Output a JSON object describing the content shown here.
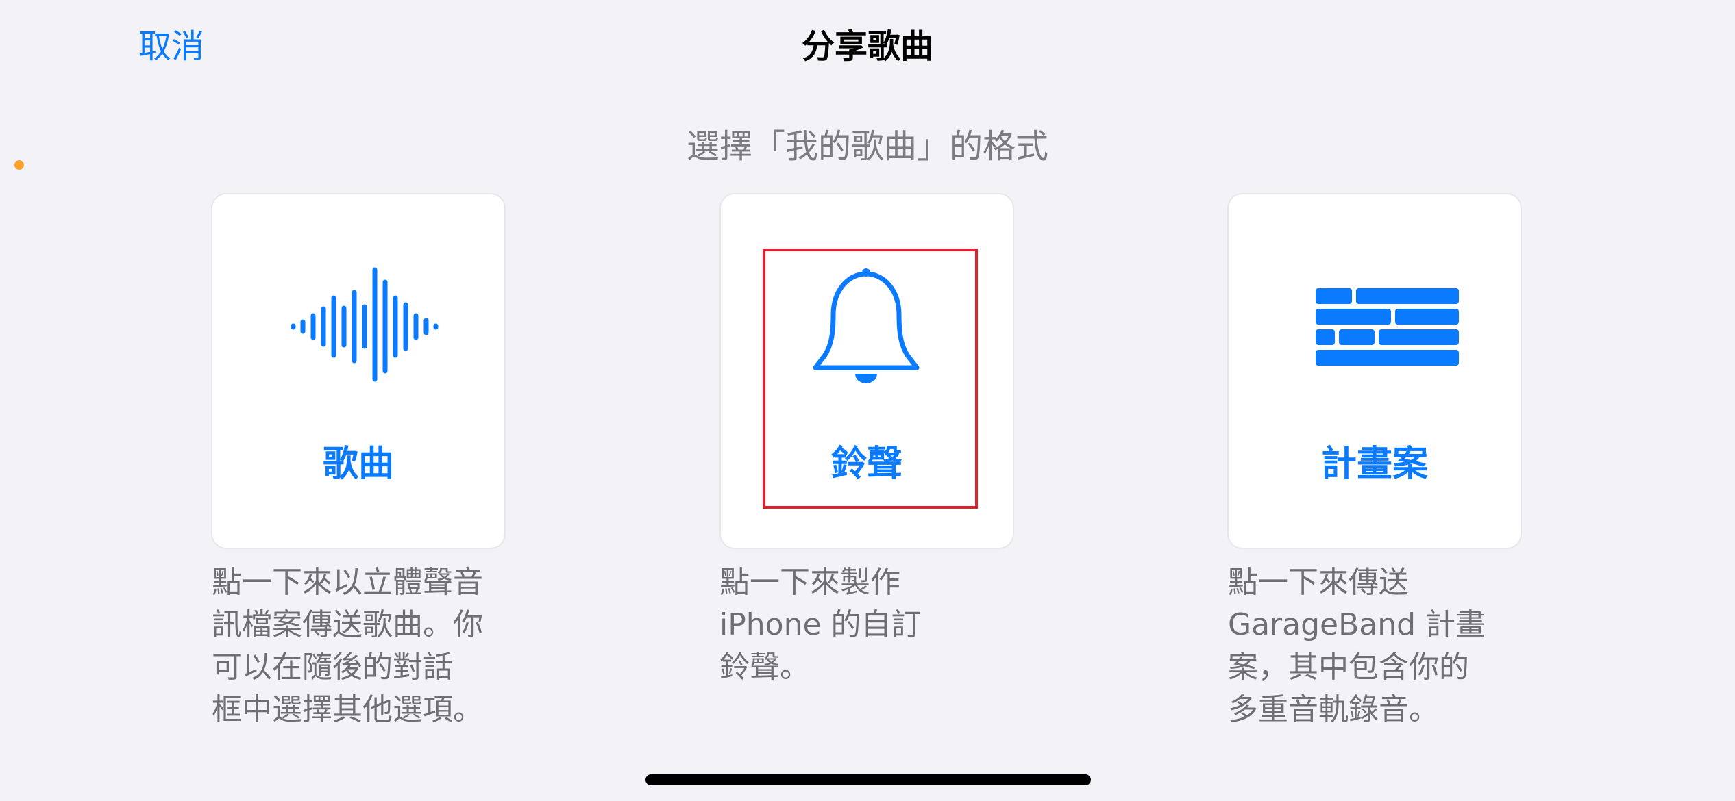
{
  "header": {
    "cancel_label": "取消",
    "title": "分享歌曲"
  },
  "subtitle": "選擇「我的歌曲」的格式",
  "options": [
    {
      "label": "歌曲",
      "icon": "waveform-icon",
      "description": "點一下來以立體聲音\n訊檔案傳送歌曲。你\n可以在隨後的對話\n框中選擇其他選項。"
    },
    {
      "label": "鈴聲",
      "icon": "bell-icon",
      "description": "點一下來製作\niPhone 的自訂\n鈴聲。"
    },
    {
      "label": "計畫案",
      "icon": "tracks-icon",
      "description": "點一下來傳送\nGarageBand 計畫\n案，其中包含你的\n多重音軌錄音。"
    }
  ],
  "colors": {
    "accent": "#0a7aff",
    "background": "#f2f2f7",
    "highlight": "#e0232e",
    "dot": "#ffa22c"
  }
}
